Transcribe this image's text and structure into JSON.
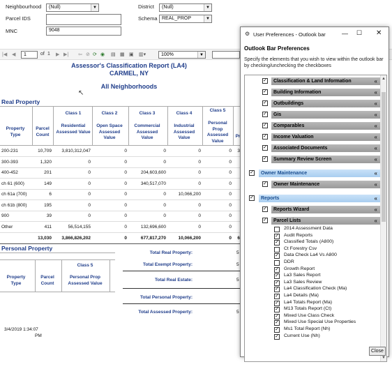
{
  "filters": {
    "neighbourhood_label": "Neighbourhood",
    "neighbourhood_value": "(Null)",
    "district_label": "District",
    "district_value": "(Null)",
    "parcel_ids_label": "Parcel IDS",
    "parcel_ids_value": "",
    "schema_label": "Schema",
    "schema_value": "REAL_PROP",
    "mnc_label": "MNC",
    "mnc_value": "9048"
  },
  "toolbar": {
    "page_value": "1",
    "of_label": "of",
    "page_total": "1",
    "zoom_value": "100%"
  },
  "report": {
    "title": "Assessor's Classification Report (LA4)",
    "subtitle": "CARMEL, NY",
    "neighborhoods": "All Neighborhoods",
    "real_section": "Real Property",
    "personal_section": "Personal Property",
    "timestamp_date": "3/4/2019 1:34:07",
    "timestamp_ampm": "PM"
  },
  "real_table": {
    "headers": {
      "property_type": "Property Type",
      "parcel_count": "Parcel Count",
      "c1_class": "Class 1",
      "c1_name": "Residential Assessed Value",
      "c2_class": "Class 2",
      "c2_name": "Open Space Assessed Value",
      "c3_class": "Class 3",
      "c3_name": "Commercial Assessed Value",
      "c4_class": "Class 4",
      "c4_name": "Industrial Assessed Value",
      "c5_class": "Class 5",
      "c5_name": "Personal Prop Assessed Value",
      "pr": "Pr"
    },
    "rows": [
      {
        "type": "200-231",
        "count": "10,709",
        "c1": "3,810,312,047",
        "c2": "0",
        "c3": "0",
        "c4": "0",
        "c5": "0",
        "pr": "3"
      },
      {
        "type": "300-393",
        "count": "1,320",
        "c1": "0",
        "c2": "0",
        "c3": "0",
        "c4": "0",
        "c5": "0",
        "pr": ""
      },
      {
        "type": "400-452",
        "count": "201",
        "c1": "0",
        "c2": "0",
        "c3": "204,603,600",
        "c4": "0",
        "c5": "0",
        "pr": ""
      },
      {
        "type": "ch 61 (600)",
        "count": "149",
        "c1": "0",
        "c2": "0",
        "c3": "340,517,070",
        "c4": "0",
        "c5": "0",
        "pr": ""
      },
      {
        "type": "ch 61a (700)",
        "count": "6",
        "c1": "0",
        "c2": "0",
        "c3": "0",
        "c4": "10,066,200",
        "c5": "0",
        "pr": ""
      },
      {
        "type": "ch 61b (800)",
        "count": "195",
        "c1": "0",
        "c2": "0",
        "c3": "0",
        "c4": "0",
        "c5": "0",
        "pr": ""
      },
      {
        "type": "900",
        "count": "39",
        "c1": "0",
        "c2": "0",
        "c3": "0",
        "c4": "0",
        "c5": "0",
        "pr": ""
      },
      {
        "type": "Other",
        "count": "411",
        "c1": "56,514,155",
        "c2": "0",
        "c3": "132,696,600",
        "c4": "0",
        "c5": "0",
        "pr": ""
      }
    ],
    "totals": {
      "count": "13,030",
      "c1": "3,866,826,202",
      "c2": "0",
      "c3": "677,817,270",
      "c4": "10,066,200",
      "c5": "0",
      "pr": "6"
    }
  },
  "personal_table": {
    "property_type": "Property Type",
    "parcel_count": "Parcel Count",
    "c5_class": "Class 5",
    "c5_name": "Personal Prop Assessed Value"
  },
  "totals_labels": {
    "real": "Total Real Property:",
    "real_v": "5",
    "exempt": "Total Exempt Property:",
    "exempt_v": "5",
    "estate": "Total Real Estate:",
    "estate_v": "5",
    "personal": "Total Personal Property:",
    "personal_v": "",
    "assessed": "Total Assessed Property:",
    "assessed_v": "5"
  },
  "dialog": {
    "title": "User Preferences - Outlook bar",
    "heading": "Outlook Bar Preferences",
    "description": "Specify the elements that you wish to view within the outlook bar by checking/unchecking the checkboxes",
    "groups": [
      {
        "label": "Classification & Land Information",
        "checked": true,
        "style": "g"
      },
      {
        "label": "Building Information",
        "checked": true,
        "style": "g"
      },
      {
        "label": "Outbuildings",
        "checked": true,
        "style": "g"
      },
      {
        "label": "Gis",
        "checked": true,
        "style": "g"
      },
      {
        "label": "Comparables",
        "checked": true,
        "style": "g"
      },
      {
        "label": "Income Valuation",
        "checked": true,
        "style": "g"
      },
      {
        "label": "Associated Documents",
        "checked": true,
        "style": "g"
      },
      {
        "label": "Summary Review Screen",
        "checked": true,
        "style": "g"
      }
    ],
    "owner_header": "Owner Maintenance",
    "owner_sub": "Owner Maintenance",
    "reports_header": "Reports",
    "reports_wizard": "Reports Wizard",
    "parcel_lists": "Parcel Lists",
    "parcel_items": [
      {
        "label": "2014 Assessment Data",
        "checked": false
      },
      {
        "label": "Audit Reports",
        "checked": true
      },
      {
        "label": "Classified Totals (A800)",
        "checked": true
      },
      {
        "label": "Ct Forestry Csv",
        "checked": false
      },
      {
        "label": "Data Check La4 Vs A800",
        "checked": true
      },
      {
        "label": "DDR",
        "checked": false
      },
      {
        "label": "Growth Report",
        "checked": true
      },
      {
        "label": "La3 Sales Report",
        "checked": true
      },
      {
        "label": "La3 Sales Review",
        "checked": true
      },
      {
        "label": "La4 Classification Check (Ma)",
        "checked": true
      },
      {
        "label": "La4 Details (Ma)",
        "checked": true
      },
      {
        "label": "La4 Totals Report (Ma)",
        "checked": true
      },
      {
        "label": "M13 Totals Report (Ct)",
        "checked": true
      },
      {
        "label": "Mixed Use Class Check",
        "checked": true
      },
      {
        "label": "Mixed Use Special Use Properties",
        "checked": true
      },
      {
        "label": "Ms1 Total Report (Nh)",
        "checked": true
      },
      {
        "label": "Current Use (Nh)",
        "checked": true
      }
    ],
    "close_label": "Close"
  }
}
